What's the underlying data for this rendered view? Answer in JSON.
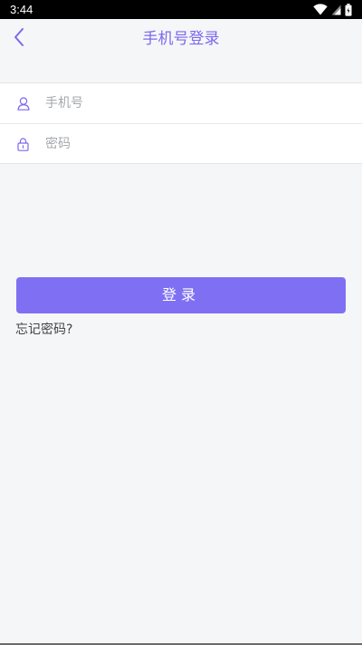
{
  "status_bar": {
    "time": "3:44",
    "icons": [
      "wifi-icon",
      "cell-signal-icon",
      "battery-icon"
    ]
  },
  "nav": {
    "back_icon": "chevron-left-icon",
    "title": "手机号登录"
  },
  "form": {
    "phone": {
      "icon": "user-icon",
      "placeholder": "手机号",
      "value": ""
    },
    "password": {
      "icon": "lock-icon",
      "placeholder": "密码",
      "value": ""
    }
  },
  "actions": {
    "login_label": "登录",
    "forgot_label": "忘记密码?"
  },
  "colors": {
    "accent": "#7b68ee",
    "button": "#7f70f3",
    "background": "#f5f6f8"
  }
}
